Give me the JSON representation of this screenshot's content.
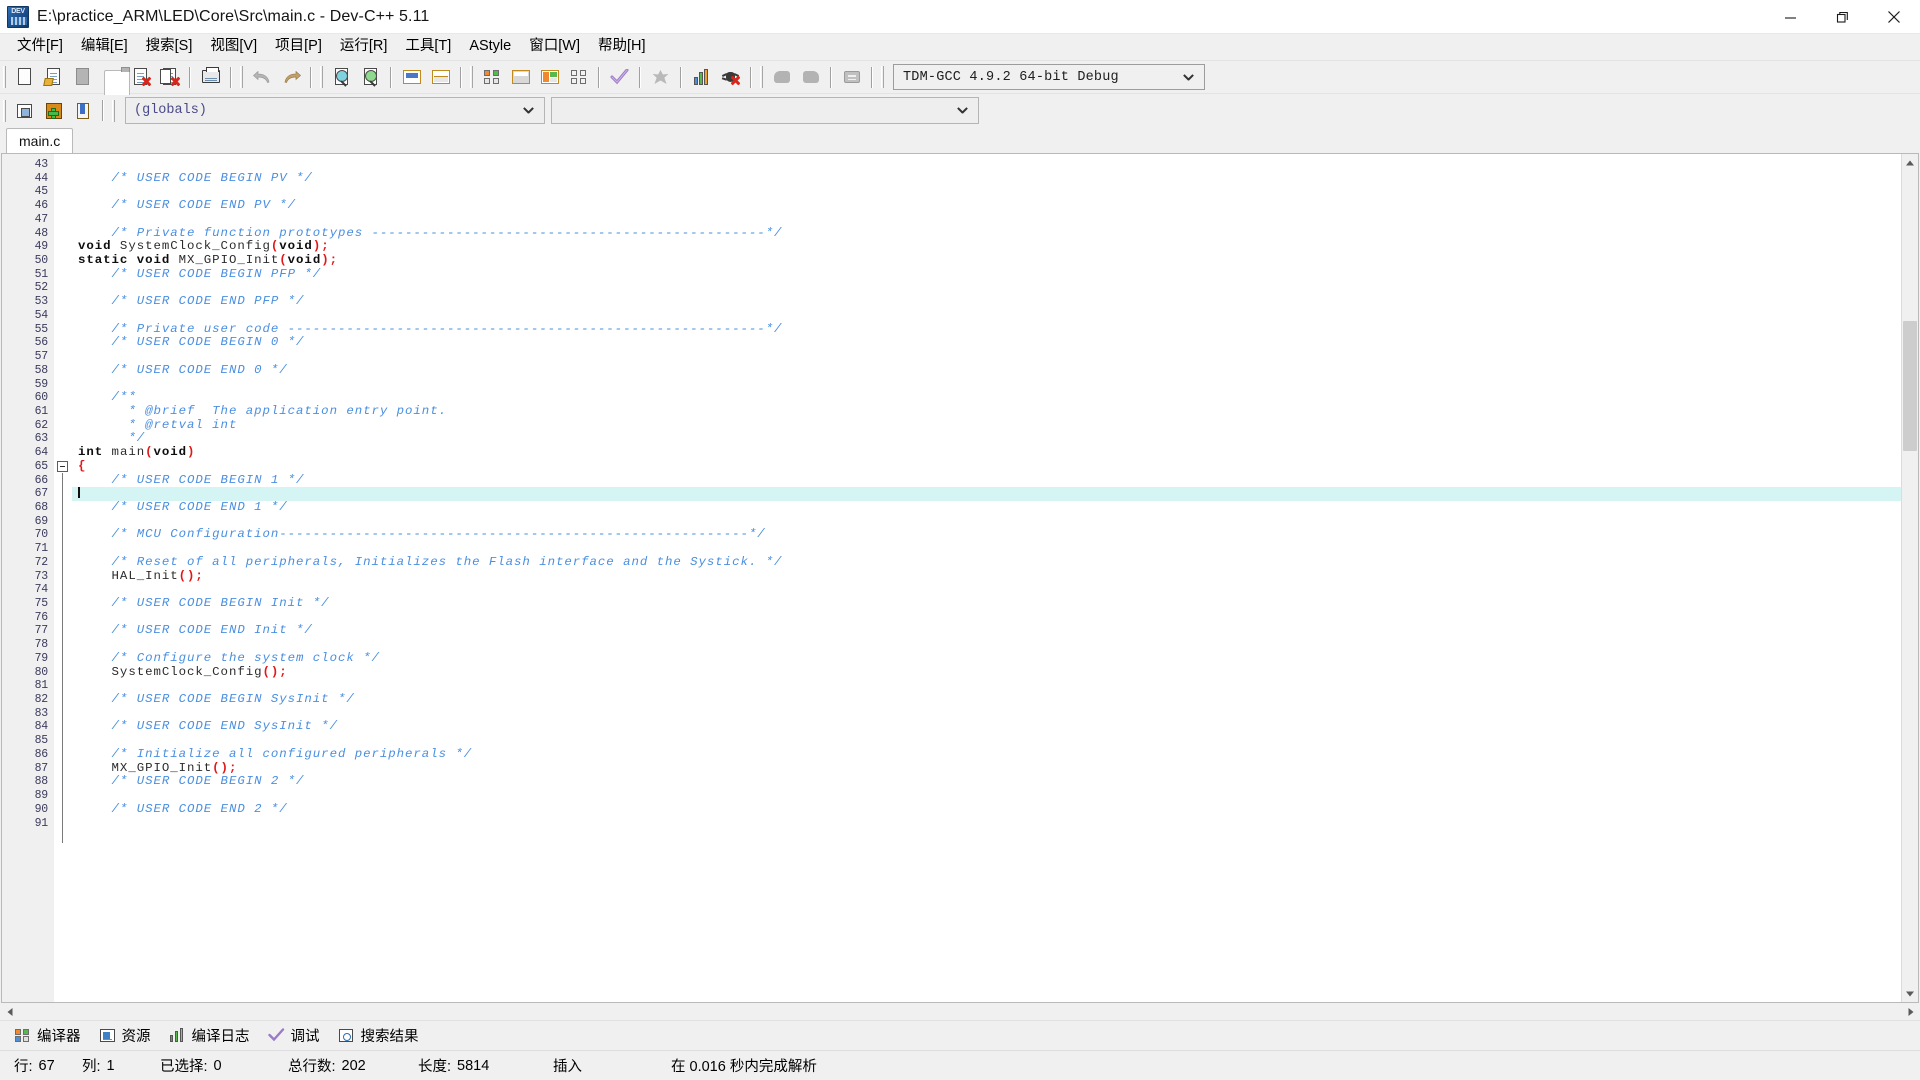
{
  "window": {
    "title": "E:\\practice_ARM\\LED\\Core\\Src\\main.c - Dev-C++ 5.11",
    "app_icon": "dev-cpp-icon",
    "minimize_label": "—",
    "restore_label": "❐",
    "close_label": "✕"
  },
  "menubar": {
    "items": [
      {
        "label": "文件[F]",
        "name": "menu-file"
      },
      {
        "label": "编辑[E]",
        "name": "menu-edit"
      },
      {
        "label": "搜索[S]",
        "name": "menu-search"
      },
      {
        "label": "视图[V]",
        "name": "menu-view"
      },
      {
        "label": "项目[P]",
        "name": "menu-project"
      },
      {
        "label": "运行[R]",
        "name": "menu-run"
      },
      {
        "label": "工具[T]",
        "name": "menu-tools"
      },
      {
        "label": "AStyle",
        "name": "menu-astyle"
      },
      {
        "label": "窗口[W]",
        "name": "menu-window"
      },
      {
        "label": "帮助[H]",
        "name": "menu-help"
      }
    ]
  },
  "toolbar": {
    "compiler_select": {
      "value": "TDM-GCC 4.9.2 64-bit Debug",
      "name": "compiler-set-select"
    },
    "globals_select": {
      "value": "(globals)",
      "name": "globals-scope-select"
    },
    "members_select": {
      "value": "",
      "name": "class-members-select"
    }
  },
  "tabs": {
    "items": [
      {
        "label": "main.c",
        "active": true
      }
    ]
  },
  "editor": {
    "first_line": 43,
    "cursor_line": 67,
    "lines": [
      {
        "n": 43,
        "tokens": []
      },
      {
        "n": 44,
        "tokens": [
          {
            "t": "cmt",
            "v": "    /* USER CODE BEGIN PV */"
          }
        ]
      },
      {
        "n": 45,
        "tokens": []
      },
      {
        "n": 46,
        "tokens": [
          {
            "t": "cmt",
            "v": "    /* USER CODE END PV */"
          }
        ]
      },
      {
        "n": 47,
        "tokens": []
      },
      {
        "n": 48,
        "tokens": [
          {
            "t": "cmt",
            "v": "    /* Private function prototypes -----------------------------------------------*/"
          }
        ]
      },
      {
        "n": 49,
        "tokens": [
          {
            "t": "kw",
            "v": "void"
          },
          {
            "t": "idn",
            "v": " SystemClock_Config"
          },
          {
            "t": "pun",
            "v": "("
          },
          {
            "t": "kw",
            "v": "void"
          },
          {
            "t": "pun",
            "v": ");"
          }
        ]
      },
      {
        "n": 50,
        "tokens": [
          {
            "t": "kw",
            "v": "static void"
          },
          {
            "t": "idn",
            "v": " MX_GPIO_Init"
          },
          {
            "t": "pun",
            "v": "("
          },
          {
            "t": "kw",
            "v": "void"
          },
          {
            "t": "pun",
            "v": ");"
          }
        ]
      },
      {
        "n": 51,
        "tokens": [
          {
            "t": "cmt",
            "v": "    /* USER CODE BEGIN PFP */"
          }
        ]
      },
      {
        "n": 52,
        "tokens": []
      },
      {
        "n": 53,
        "tokens": [
          {
            "t": "cmt",
            "v": "    /* USER CODE END PFP */"
          }
        ]
      },
      {
        "n": 54,
        "tokens": []
      },
      {
        "n": 55,
        "tokens": [
          {
            "t": "cmt",
            "v": "    /* Private user code ---------------------------------------------------------*/"
          }
        ]
      },
      {
        "n": 56,
        "tokens": [
          {
            "t": "cmt",
            "v": "    /* USER CODE BEGIN 0 */"
          }
        ]
      },
      {
        "n": 57,
        "tokens": []
      },
      {
        "n": 58,
        "tokens": [
          {
            "t": "cmt",
            "v": "    /* USER CODE END 0 */"
          }
        ]
      },
      {
        "n": 59,
        "tokens": []
      },
      {
        "n": 60,
        "tokens": [
          {
            "t": "cmt",
            "v": "    /**"
          }
        ]
      },
      {
        "n": 61,
        "tokens": [
          {
            "t": "cmt",
            "v": "      * @brief  The application entry point."
          }
        ]
      },
      {
        "n": 62,
        "tokens": [
          {
            "t": "cmt",
            "v": "      * @retval int"
          }
        ]
      },
      {
        "n": 63,
        "tokens": [
          {
            "t": "cmt",
            "v": "      */"
          }
        ]
      },
      {
        "n": 64,
        "tokens": [
          {
            "t": "kw",
            "v": "int"
          },
          {
            "t": "idn",
            "v": " main"
          },
          {
            "t": "pun",
            "v": "("
          },
          {
            "t": "kw",
            "v": "void"
          },
          {
            "t": "pun",
            "v": ")"
          }
        ]
      },
      {
        "n": 65,
        "tokens": [
          {
            "t": "pun",
            "v": "{"
          }
        ],
        "fold": true
      },
      {
        "n": 66,
        "tokens": [
          {
            "t": "cmt",
            "v": "    /* USER CODE BEGIN 1 */"
          }
        ]
      },
      {
        "n": 67,
        "tokens": [],
        "caret": true,
        "highlight": true
      },
      {
        "n": 68,
        "tokens": [
          {
            "t": "cmt",
            "v": "    /* USER CODE END 1 */"
          }
        ]
      },
      {
        "n": 69,
        "tokens": []
      },
      {
        "n": 70,
        "tokens": [
          {
            "t": "cmt",
            "v": "    /* MCU Configuration--------------------------------------------------------*/"
          }
        ]
      },
      {
        "n": 71,
        "tokens": []
      },
      {
        "n": 72,
        "tokens": [
          {
            "t": "cmt",
            "v": "    /* Reset of all peripherals, Initializes the Flash interface and the Systick. */"
          }
        ]
      },
      {
        "n": 73,
        "tokens": [
          {
            "t": "idn",
            "v": "    HAL_Init"
          },
          {
            "t": "pun",
            "v": "();"
          }
        ]
      },
      {
        "n": 74,
        "tokens": []
      },
      {
        "n": 75,
        "tokens": [
          {
            "t": "cmt",
            "v": "    /* USER CODE BEGIN Init */"
          }
        ]
      },
      {
        "n": 76,
        "tokens": []
      },
      {
        "n": 77,
        "tokens": [
          {
            "t": "cmt",
            "v": "    /* USER CODE END Init */"
          }
        ]
      },
      {
        "n": 78,
        "tokens": []
      },
      {
        "n": 79,
        "tokens": [
          {
            "t": "cmt",
            "v": "    /* Configure the system clock */"
          }
        ]
      },
      {
        "n": 80,
        "tokens": [
          {
            "t": "idn",
            "v": "    SystemClock_Config"
          },
          {
            "t": "pun",
            "v": "();"
          }
        ]
      },
      {
        "n": 81,
        "tokens": []
      },
      {
        "n": 82,
        "tokens": [
          {
            "t": "cmt",
            "v": "    /* USER CODE BEGIN SysInit */"
          }
        ]
      },
      {
        "n": 83,
        "tokens": []
      },
      {
        "n": 84,
        "tokens": [
          {
            "t": "cmt",
            "v": "    /* USER CODE END SysInit */"
          }
        ]
      },
      {
        "n": 85,
        "tokens": []
      },
      {
        "n": 86,
        "tokens": [
          {
            "t": "cmt",
            "v": "    /* Initialize all configured peripherals */"
          }
        ]
      },
      {
        "n": 87,
        "tokens": [
          {
            "t": "idn",
            "v": "    MX_GPIO_Init"
          },
          {
            "t": "pun",
            "v": "();"
          }
        ]
      },
      {
        "n": 88,
        "tokens": [
          {
            "t": "cmt",
            "v": "    /* USER CODE BEGIN 2 */"
          }
        ]
      },
      {
        "n": 89,
        "tokens": []
      },
      {
        "n": 90,
        "tokens": [
          {
            "t": "cmt",
            "v": "    /* USER CODE END 2 */"
          }
        ]
      },
      {
        "n": 91,
        "tokens": []
      }
    ]
  },
  "bottom_tabs": {
    "items": [
      {
        "label": "编译器",
        "icon": "compiler-icon"
      },
      {
        "label": "资源",
        "icon": "resources-icon"
      },
      {
        "label": "编译日志",
        "icon": "compile-log-icon"
      },
      {
        "label": "调试",
        "icon": "debug-icon"
      },
      {
        "label": "搜索结果",
        "icon": "search-results-icon"
      }
    ]
  },
  "statusbar": {
    "row_label": "行:",
    "row_value": "67",
    "col_label": "列:",
    "col_value": "1",
    "sel_label": "已选择:",
    "sel_value": "0",
    "total_label": "总行数:",
    "total_value": "202",
    "length_label": "长度:",
    "length_value": "5814",
    "insert_mode": "插入",
    "parse_status": "在 0.016 秒内完成解析"
  },
  "colors": {
    "comment": "#4a8fe0",
    "punctuation": "#e01818",
    "keyword": "#0d0d0d",
    "current_line": "#d5f5f5",
    "chrome": "#f0f0f0"
  }
}
